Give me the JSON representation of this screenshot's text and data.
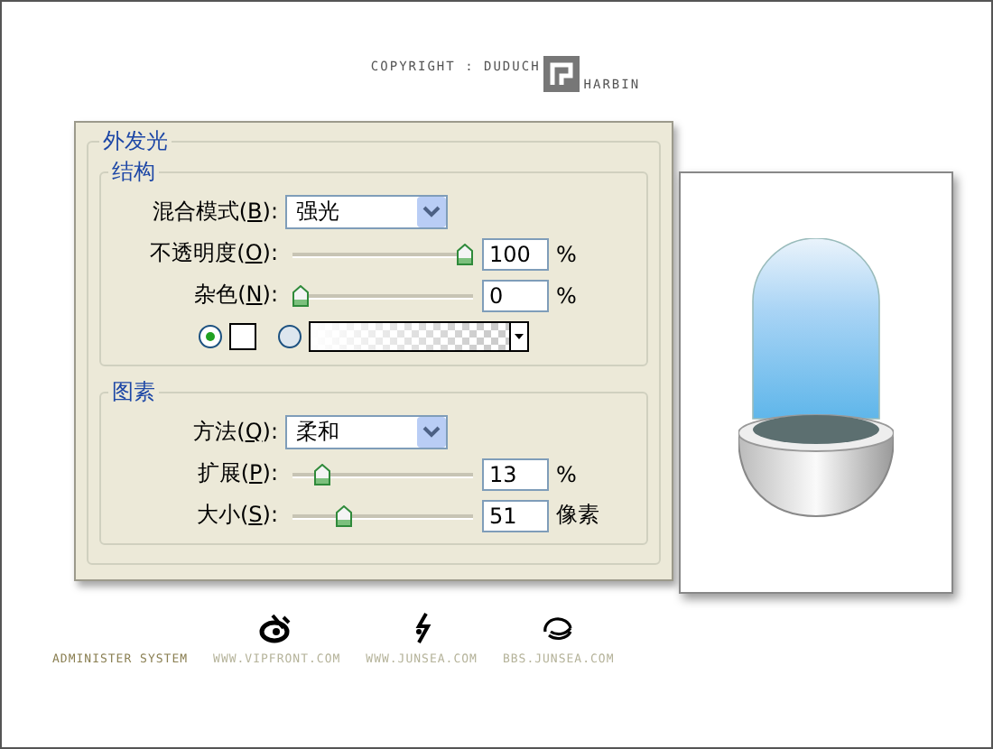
{
  "header": {
    "copyright": "COPYRIGHT : DUDUCH",
    "location": "HARBIN"
  },
  "dialog": {
    "title": "外发光",
    "sections": [
      {
        "title": "结构",
        "rows": [
          {
            "kind": "select",
            "label_before": "混合模式(",
            "access_key": "B",
            "label_after": "):",
            "value": "强光"
          },
          {
            "kind": "slider",
            "label_before": "不透明度(",
            "access_key": "O",
            "label_after": "):",
            "level": 1,
            "value": "100",
            "unit": "%"
          },
          {
            "kind": "slider",
            "label_before": "杂色(",
            "access_key": "N",
            "label_after": "):",
            "level": 0,
            "value": "0",
            "unit": "%"
          },
          {
            "kind": "color",
            "options": [
              {
                "kind": "swatch",
                "selected": true
              },
              {
                "kind": "gradient",
                "selected": false
              }
            ]
          }
        ]
      },
      {
        "title": "图素",
        "rows": [
          {
            "kind": "select",
            "label_before": "方法(",
            "access_key": "Q",
            "label_after": "):",
            "value": "柔和"
          },
          {
            "kind": "slider",
            "label_before": "扩展(",
            "access_key": "P",
            "label_after": "):",
            "level": 0.13,
            "value": "13",
            "unit": "%"
          },
          {
            "kind": "slider",
            "label_before": "大小(",
            "access_key": "S",
            "label_after": "):",
            "level": 0.26,
            "value": "51",
            "unit": "像素"
          }
        ]
      }
    ]
  },
  "footer": [
    {
      "kind": "text",
      "label": "ADMINISTER SYSTEM"
    },
    {
      "kind": "eye",
      "label": "WWW.VIPFRONT.COM"
    },
    {
      "kind": "bolt",
      "label": "WWW.JUNSEA.COM"
    },
    {
      "kind": "swirl",
      "label": "BBS.JUNSEA.COM"
    }
  ]
}
